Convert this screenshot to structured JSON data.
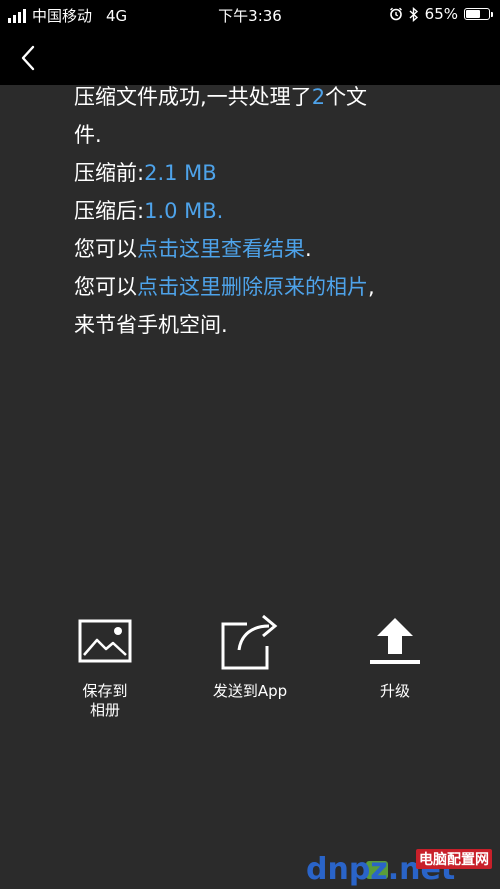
{
  "status_bar": {
    "carrier": "中国移动",
    "network": "4G",
    "time": "下午3:36",
    "battery_percent": "65%",
    "battery_level": 0.65
  },
  "nav": {
    "back_icon": "chevron-left-icon"
  },
  "message": {
    "line1_prefix": "压缩文件成功,一共处理了",
    "line1_count": "2",
    "line1_suffix": "个文",
    "line2": "件.",
    "before_label": "压缩前:",
    "before_value": "2.1 MB",
    "after_label": "压缩后:",
    "after_value": "1.0 MB.",
    "view_prefix": "您可以",
    "view_link": "点击这里查看结果",
    "view_suffix": ".",
    "delete_prefix": "您可以",
    "delete_link": "点击这里删除原来的相片",
    "delete_suffix": ",",
    "last_line": "来节省手机空间."
  },
  "actions": [
    {
      "icon": "photo-icon",
      "label": "保存到\n相册"
    },
    {
      "icon": "share-icon",
      "label": "发送到App"
    },
    {
      "icon": "upload-icon",
      "label": "升级"
    }
  ],
  "watermark": {
    "text1": "dnpz.net",
    "text2": "电脑配置网"
  },
  "colors": {
    "background": "#2b2b2b",
    "bars": "#000000",
    "link": "#4ea3ea"
  }
}
